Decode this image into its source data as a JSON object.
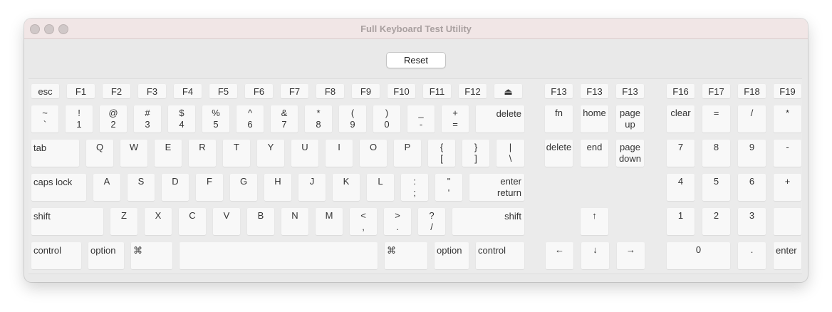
{
  "window": {
    "title": "Full Keyboard Test Utility",
    "traffic_lights": [
      "close",
      "minimize",
      "zoom"
    ]
  },
  "reset_label": "Reset",
  "keys": {
    "esc": "esc",
    "f1": "F1",
    "f2": "F2",
    "f3": "F3",
    "f4": "F4",
    "f5": "F5",
    "f6": "F6",
    "f7": "F7",
    "f8": "F8",
    "f9": "F9",
    "f10": "F10",
    "f11": "F11",
    "f12": "F12",
    "eject": "⏏",
    "f13a": "F13",
    "f13b": "F13",
    "f13c": "F13",
    "f16": "F16",
    "f17": "F17",
    "f18": "F18",
    "f19": "F19",
    "grave": [
      "~",
      "`"
    ],
    "d1": [
      "!",
      "1"
    ],
    "d2": [
      "@",
      "2"
    ],
    "d3": [
      "#",
      "3"
    ],
    "d4": [
      "$",
      "4"
    ],
    "d5": [
      "%",
      "5"
    ],
    "d6": [
      "^",
      "6"
    ],
    "d7": [
      "&",
      "7"
    ],
    "d8": [
      "*",
      "8"
    ],
    "d9": [
      "(",
      "9"
    ],
    "d0": [
      ")",
      "0"
    ],
    "minus": [
      "_",
      "-"
    ],
    "equal": [
      "+",
      "="
    ],
    "delete": "delete",
    "fn": "fn",
    "home": "home",
    "pageup": [
      "page",
      "up"
    ],
    "clear": "clear",
    "npeq": "=",
    "npdiv": "/",
    "npmul": "*",
    "tab": "tab",
    "q": "Q",
    "w": "W",
    "e": "E",
    "r": "R",
    "t": "T",
    "y": "Y",
    "u": "U",
    "i": "I",
    "o": "O",
    "p": "P",
    "lbracket": [
      "{",
      "["
    ],
    "rbracket": [
      "}",
      "]"
    ],
    "backslash": [
      "|",
      "\\"
    ],
    "fwddelete": "delete",
    "end": "end",
    "pagedown": [
      "page",
      "down"
    ],
    "np7": "7",
    "np8": "8",
    "np9": "9",
    "npminus": "-",
    "capslock": "caps lock",
    "a": "A",
    "s": "S",
    "d": "D",
    "f": "F",
    "g": "G",
    "h": "H",
    "j": "J",
    "k": "K",
    "l": "L",
    "semicolon": [
      ":",
      ";"
    ],
    "quote": [
      "\"",
      "'"
    ],
    "enterreturn": [
      "enter",
      "return"
    ],
    "np4": "4",
    "np5": "5",
    "np6": "6",
    "npplus": "+",
    "lshift": "shift",
    "z": "Z",
    "x": "X",
    "c": "C",
    "v": "V",
    "b": "B",
    "n": "N",
    "m": "M",
    "comma": [
      "<",
      ","
    ],
    "period": [
      ">",
      "."
    ],
    "slash": [
      "?",
      "/"
    ],
    "rshift": "shift",
    "up": "↑",
    "np1": "1",
    "np2": "2",
    "np3": "3",
    "npblank": "",
    "lcontrol": "control",
    "loption": "option",
    "lcmd": "⌘",
    "space": "",
    "rcmd": "⌘",
    "roption": "option",
    "rcontrol": "control",
    "left": "←",
    "down": "↓",
    "right": "→",
    "np0": "0",
    "npdot": ".",
    "npenter": "enter"
  }
}
